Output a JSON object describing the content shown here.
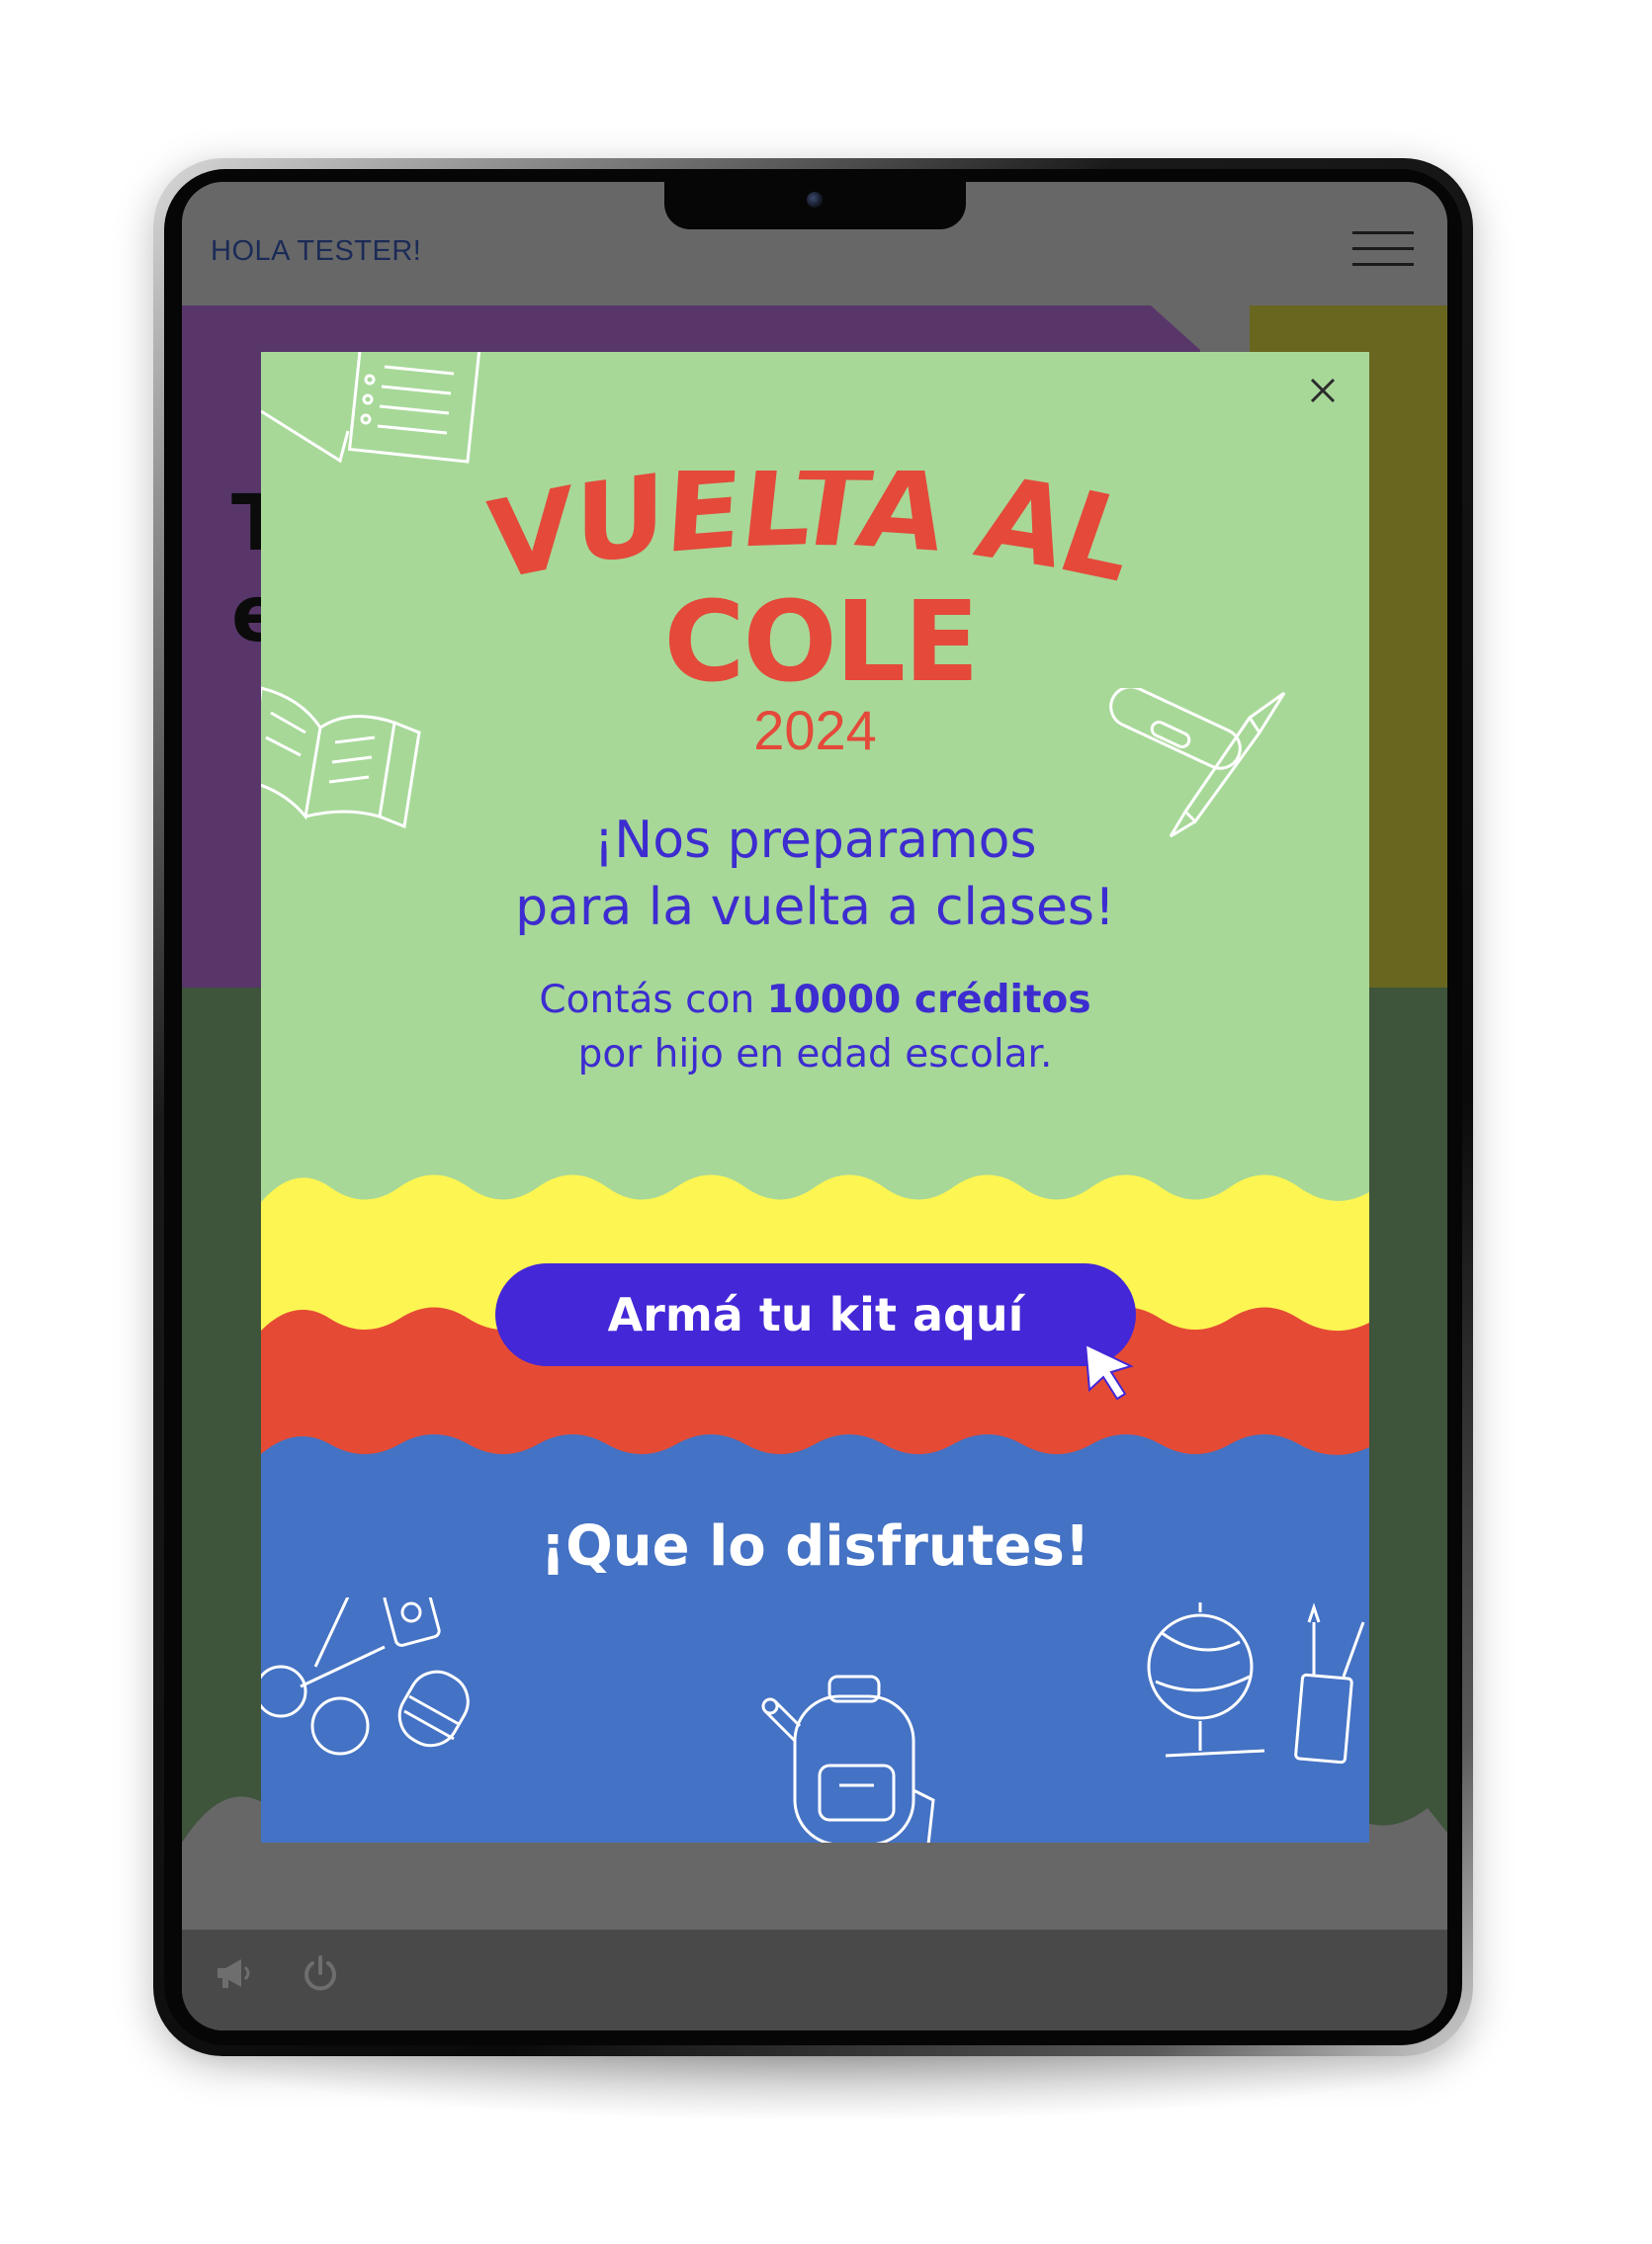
{
  "header": {
    "greeting": "HOLA TESTER!",
    "menu_icon": "hamburger-menu-icon"
  },
  "background_page": {
    "partial_text": "T\ne"
  },
  "promo_modal": {
    "close_icon": "close-icon",
    "title_line1": "VUELTA AL",
    "title_line2": "COLE",
    "year": "2024",
    "headline_line1": "¡Nos preparamos",
    "headline_line2": "para la vuelta a clases!",
    "credits_prefix": "Contás con ",
    "credits_bold": "10000 créditos",
    "credits_line2": "por hijo en edad escolar.",
    "cta_label": "Armá tu kit aquí",
    "closing_text": "¡Que lo disfrutes!"
  },
  "bottom_bar": {
    "icons": [
      "megaphone-icon",
      "power-icon"
    ]
  },
  "colors": {
    "modal_green": "#a7d898",
    "wave_yellow": "#fdf552",
    "wave_red": "#e54b34",
    "modal_blue": "#4472c4",
    "title_red": "#e4493a",
    "text_purple": "#3d2cd0",
    "cta_purple": "#4427d6"
  }
}
